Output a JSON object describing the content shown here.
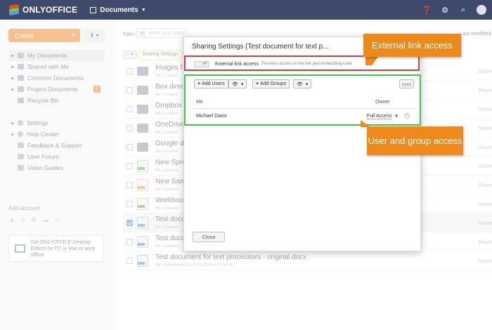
{
  "header": {
    "brand": "ONLYOFFICE",
    "module": "Documents",
    "brand_colors": [
      "#e94e1b",
      "#8bc34a",
      "#4ea3dd"
    ],
    "icons": [
      "help-icon",
      "settings-icon",
      "search-icon",
      "user-avatar"
    ]
  },
  "sidebar": {
    "create_label": "Create",
    "nav": [
      {
        "label": "My Documents",
        "active": true,
        "icon": "folder-user-icon"
      },
      {
        "label": "Shared with Me",
        "icon": "folder-shared-icon"
      },
      {
        "label": "Common Documents",
        "icon": "folder-common-icon"
      },
      {
        "label": "Project Documents",
        "icon": "folder-projects-icon",
        "badge": "6"
      },
      {
        "label": "Recycle Bin",
        "icon": "trash-icon"
      }
    ],
    "nav2": [
      {
        "label": "Settings",
        "icon": "gear-icon"
      },
      {
        "label": "Help Center",
        "icon": "help-icon"
      },
      {
        "label": "Feedback & Support",
        "icon": "feedback-icon"
      },
      {
        "label": "User Forum",
        "icon": "forum-icon"
      },
      {
        "label": "Video Guides",
        "icon": "video-icon"
      }
    ],
    "add_account": "Add account",
    "promo": "Get ONLYOFFICE Desktop Editors for PC or Mac to work offline"
  },
  "main": {
    "filter_label": "Filter:",
    "filter_placeholder": "enter your query",
    "sort_label": "Last modified",
    "sharing_settings_action": "Sharing Settings",
    "files": [
      {
        "name": "Images f",
        "meta": "Me | Created",
        "type": "folder",
        "share": "Share"
      },
      {
        "name": "Box direc",
        "meta": "Me | Created",
        "type": "folder",
        "share": "Share"
      },
      {
        "name": "Dropbox",
        "meta": "Me | Created",
        "type": "folder",
        "share": "Share"
      },
      {
        "name": "OneDrive",
        "meta": "Me | Created",
        "type": "folder",
        "share": "Share"
      },
      {
        "name": "Google d",
        "meta": "Me | Created",
        "type": "folder",
        "share": "Share"
      },
      {
        "name": "New Spre",
        "meta": "Me | Updated",
        "type": "sheet",
        "share": "Share"
      },
      {
        "name": "New Sam",
        "meta": "Me | Updated",
        "type": "slide",
        "share": "Share"
      },
      {
        "name": "Workboo",
        "meta": "Me | Updated",
        "type": "sheet",
        "share": "Share"
      },
      {
        "name": "Test docu",
        "meta": "Me | Updated",
        "type": "doc",
        "share": "Share",
        "selected": true
      },
      {
        "name": "Test docu",
        "meta": "Me | Updated",
        "type": "doc",
        "share": "Share"
      },
      {
        "name": "Test document for text processors - original.docx",
        "meta": "Me | Uploaded 6/30/2020 5:59 PM | 77.55 KB",
        "type": "doc",
        "share": "Share"
      }
    ]
  },
  "dialog": {
    "title": "Sharing Settings (Test document for text p...",
    "toggle_state": "off",
    "external_link_label": "External link access",
    "external_link_desc": "Provides access to the link and embedding code",
    "add_users": "Add Users",
    "add_groups": "Add Groups",
    "col_me": "Me",
    "col_owner": "Owner",
    "user_name": "Michael Davis",
    "user_access": "Full Access",
    "close": "Close"
  },
  "callouts": {
    "external": "External link access",
    "users": "User and group access",
    "color": "#ee8a1c",
    "external_box_color": "#e23a3a",
    "users_box_color": "#3dcc3d"
  }
}
